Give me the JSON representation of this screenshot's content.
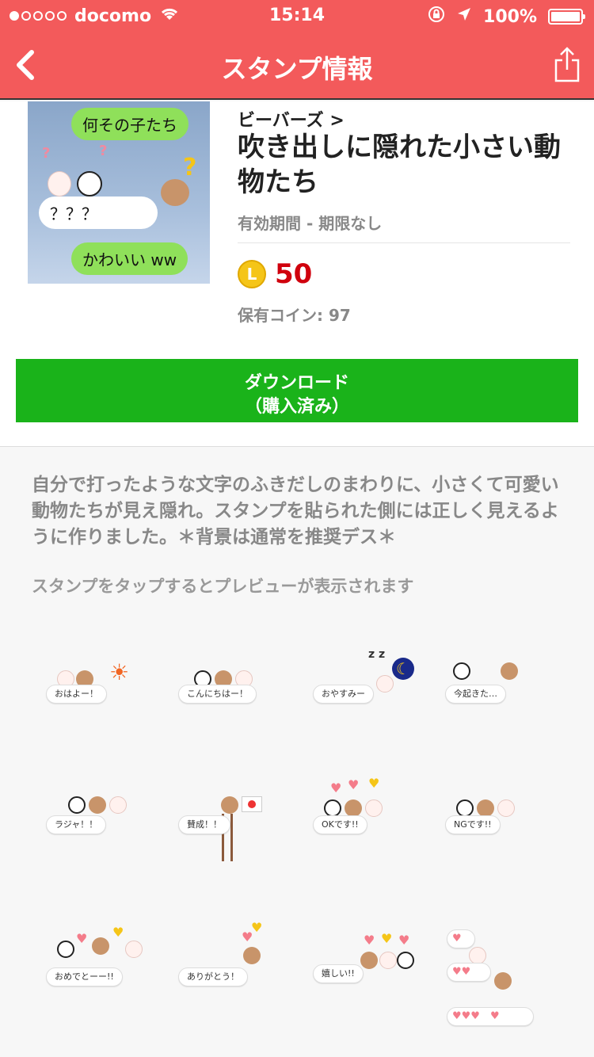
{
  "status": {
    "carrier": "docomo",
    "time": "15:14",
    "battery": "100%"
  },
  "nav": {
    "title": "スタンプ情報"
  },
  "product": {
    "author": "ビーバーズ >",
    "title": "吹き出しに隠れた小さい動物たち",
    "validity": "有効期間 - 期限なし",
    "price": "50",
    "coin_letter": "L",
    "owned": "保有コイン: 97",
    "thumb_bubbles": [
      "何その子たち",
      "？？？",
      "かわいい ww"
    ]
  },
  "download": {
    "line1": "ダウンロード",
    "line2": "（購入済み）"
  },
  "description": "自分で打ったような文字のふきだしのまわりに、小さくて可愛い動物たちが見え隠れ。スタンプを貼られた側には正しく見えるように作りました。＊背景は通常を推奨デス＊",
  "hint": "スタンプをタップするとプレビューが表示されます",
  "stamps": [
    "おはよー！",
    "こんにちはー！",
    "おやすみー",
    "今起きた…",
    "ラジャ！！",
    "賛成！！",
    "OKです!!",
    "NGです!!",
    "おめでとーー!!",
    "ありがとう！",
    "嬉しい!!",
    ""
  ],
  "colors": {
    "header": "#f35a5b",
    "download_button": "#1ab31a",
    "price": "#d0000d"
  }
}
